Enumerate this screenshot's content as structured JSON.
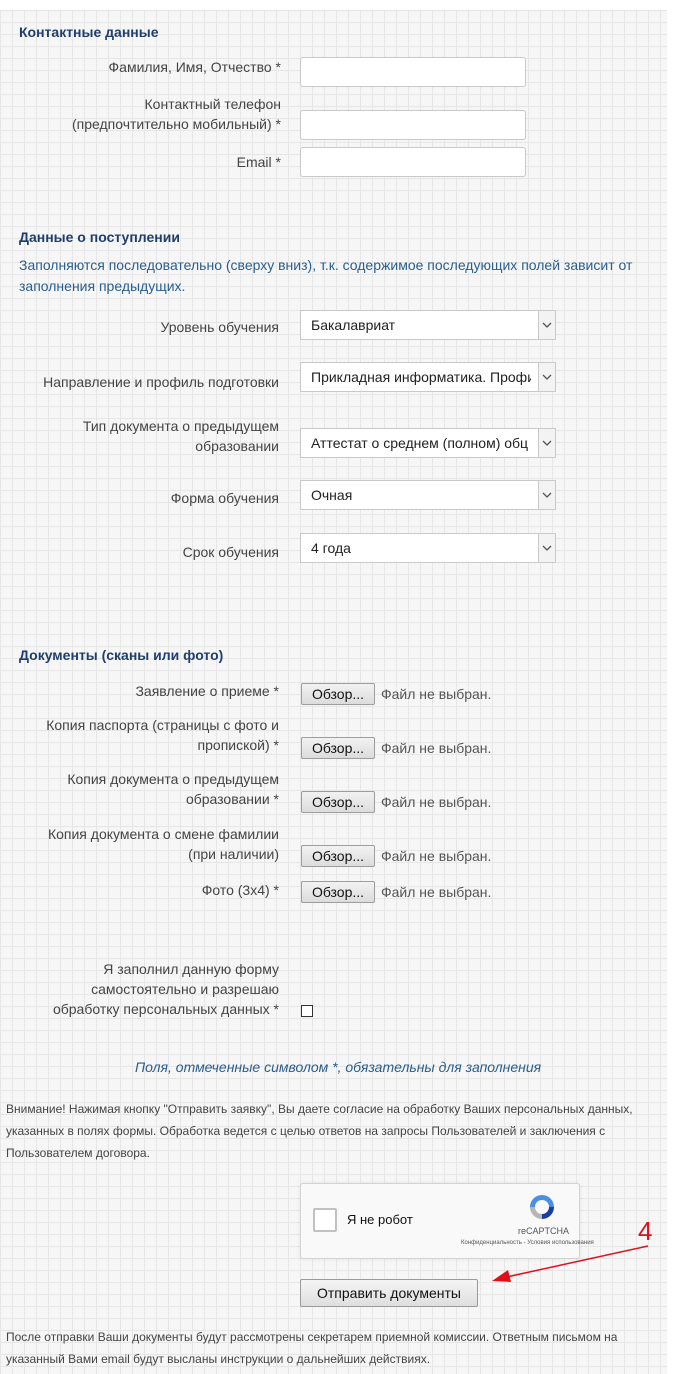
{
  "contact": {
    "title": "Контактные данные",
    "fio_label": "Фамилия, Имя, Отчество *",
    "phone_label_line1": "Контактный телефон",
    "phone_label_line2": "(предпочтительно мобильный) *",
    "email_label": "Email *"
  },
  "admission": {
    "title": "Данные о поступлении",
    "note_line1": "Заполняются последовательно (сверху вниз), т.к. содержимое последующих полей зависит от",
    "note_line2": "заполнения предыдущих.",
    "level_label": "Уровень обучения",
    "level_value": "Бакалавриат",
    "direction_label": "Направление и профиль подготовки",
    "direction_value": "Прикладная информатика. Профи",
    "doc_type_label_line1": "Тип документа о предыдущем",
    "doc_type_label_line2": "образовании",
    "doc_type_value": "Аттестат о среднем (полном) обц",
    "form_label": "Форма обучения",
    "form_value": "Очная",
    "term_label": "Срок обучения",
    "term_value": "4 года"
  },
  "documents": {
    "title": "Документы (сканы или фото)",
    "browse_label": "Обзор...",
    "no_file": "Файл не выбран.",
    "application_label": "Заявление о приеме *",
    "passport_label_line1": "Копия паспорта (страницы с фото и",
    "passport_label_line2": "пропиской) *",
    "prev_doc_label_line1": "Копия документа о предыдущем",
    "prev_doc_label_line2": "образовании *",
    "name_change_label_line1": "Копия документа о смене фамилии",
    "name_change_label_line2": "(при наличии)",
    "photo_label": "Фото (3x4) *"
  },
  "consent": {
    "line1": "Я заполнил данную форму",
    "line2": "самостоятельно и разрешаю",
    "line3": "обработку персональных данных *"
  },
  "required_note": "Поля, отмеченные символом *, обязательны для заполнения",
  "warning": {
    "line1": "Внимание! Нажимая кнопку \"Отправить заявку\", Вы даете согласие на обработку Ваших персональных данных,",
    "line2": "указанных в полях формы. Обработка ведется с целью ответов на запросы Пользователей и заключения с",
    "line3": "Пользователем договора."
  },
  "captcha": {
    "label": "Я не робот",
    "brand": "reCAPTCHA",
    "terms": "Конфиденциальность - Условия использования"
  },
  "submit_label": "Отправить документы",
  "annotation_number": "4",
  "footer": {
    "line1": "После отправки Ваши документы будут рассмотрены секретарем приемной комиссии. Ответным письмом на",
    "line2": "указанный Вами email будут высланы инструкции о дальнейших действиях."
  },
  "colors": {
    "section_title": "#1f3f6a",
    "blue_text": "#2a5e8c",
    "annotation_red": "#e0101a"
  }
}
